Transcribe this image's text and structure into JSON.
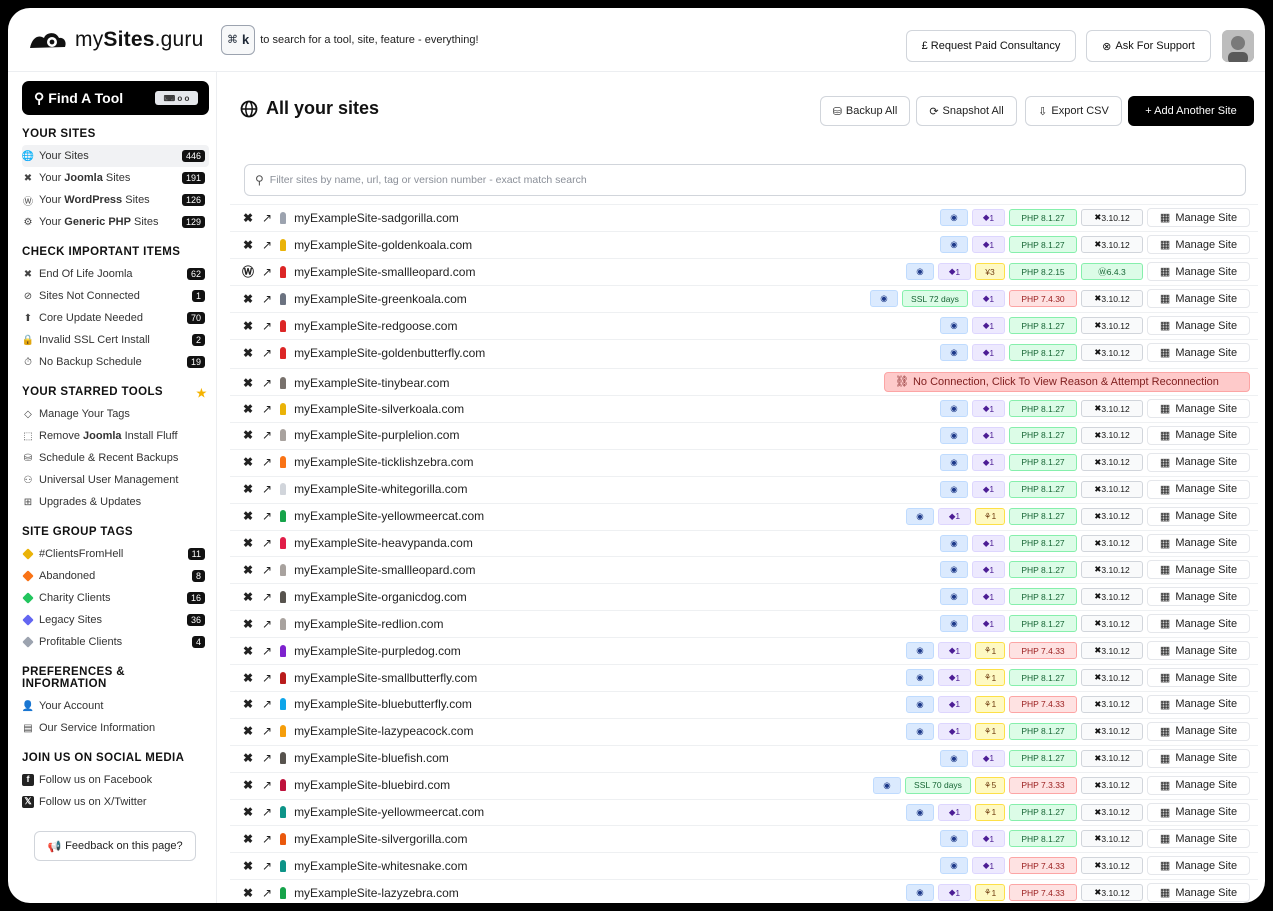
{
  "brand": {
    "prefix": "my",
    "bold": "Sites",
    "suffix": ".guru"
  },
  "topbar": {
    "kbd_symbol": "⌘",
    "kbd_key": "k",
    "search_hint": "to search for a tool, site, feature - everything!",
    "consultancy_label": "£ Request Paid Consultancy",
    "support_label": "Ask For Support"
  },
  "sidebar": {
    "find_tool": "Find A Tool",
    "find_tool_pill": "⌨ o o",
    "sections": {
      "your_sites": "YOUR SITES",
      "check": "CHECK IMPORTANT ITEMS",
      "starred": "YOUR STARRED TOOLS",
      "tags": "SITE GROUP TAGS",
      "prefs": "PREFERENCES & INFORMATION",
      "social": "JOIN US ON SOCIAL MEDIA"
    },
    "your_sites": [
      {
        "pre": "Your Sites",
        "bold": "",
        "post": "",
        "count": "446"
      },
      {
        "pre": "Your ",
        "bold": "Joomla",
        "post": " Sites",
        "count": "191"
      },
      {
        "pre": "Your ",
        "bold": "WordPress",
        "post": " Sites",
        "count": "126"
      },
      {
        "pre": "Your ",
        "bold": "Generic PHP",
        "post": " Sites",
        "count": "129"
      }
    ],
    "check": [
      {
        "label": "End Of Life Joomla",
        "count": "62"
      },
      {
        "label": "Sites Not Connected",
        "count": "1"
      },
      {
        "label": "Core Update Needed",
        "count": "70"
      },
      {
        "label": "Invalid SSL Cert Install",
        "count": "2"
      },
      {
        "label": "No Backup Schedule",
        "count": "19"
      }
    ],
    "starred": [
      {
        "pre": "Manage Your Tags",
        "bold": "",
        "post": ""
      },
      {
        "pre": "Remove ",
        "bold": "Joomla",
        "post": " Install Fluff"
      },
      {
        "pre": "Schedule & Recent Backups",
        "bold": "",
        "post": ""
      },
      {
        "pre": "Universal User Management",
        "bold": "",
        "post": ""
      },
      {
        "pre": "Upgrades & Updates",
        "bold": "",
        "post": ""
      }
    ],
    "tags": [
      {
        "label": "#ClientsFromHell",
        "count": "11",
        "color": "#eab308"
      },
      {
        "label": "Abandoned",
        "count": "8",
        "color": "#f97316"
      },
      {
        "label": "Charity Clients",
        "count": "16",
        "color": "#22c55e"
      },
      {
        "label": "Legacy Sites",
        "count": "36",
        "color": "#6366f1"
      },
      {
        "label": "Profitable Clients",
        "count": "4",
        "color": "#9ca3af"
      }
    ],
    "prefs": [
      "Your Account",
      "Our Service Information"
    ],
    "social": [
      "Follow us on Facebook",
      "Follow us on X/Twitter"
    ],
    "feedback": "Feedback on this page?"
  },
  "main": {
    "title": "All your sites",
    "backup_all": "Backup All",
    "snapshot_all": "Snapshot All",
    "export_csv": "Export CSV",
    "add_site": "+ Add Another Site",
    "filter_placeholder": "Filter sites by name, url, tag or version number - exact match search",
    "manage_label": "Manage Site",
    "no_connection": "No Connection, Click To View Reason & Attempt Reconnection"
  },
  "sites": [
    {
      "name": "myExampleSite-sadgorilla.com",
      "cms": "joomla",
      "color": "#9ca3af",
      "ssl": "",
      "tag": "1",
      "extra": "",
      "php": "PHP 8.1.27",
      "php_old": false,
      "ver": "3.10.12"
    },
    {
      "name": "myExampleSite-goldenkoala.com",
      "cms": "joomla",
      "color": "#eab308",
      "ssl": "",
      "tag": "1",
      "extra": "",
      "php": "PHP 8.1.27",
      "php_old": false,
      "ver": "3.10.12"
    },
    {
      "name": "myExampleSite-smallleopard.com",
      "cms": "wordpress",
      "color": "#dc2626",
      "ssl": "",
      "tag": "1",
      "extra": "¥3",
      "php": "PHP 8.2.15",
      "php_old": false,
      "ver": "6.4.3"
    },
    {
      "name": "myExampleSite-greenkoala.com",
      "cms": "joomla",
      "color": "#6b7280",
      "ssl": "SSL 72 days",
      "tag": "1",
      "extra": "",
      "php": "PHP 7.4.30",
      "php_old": true,
      "ver": "3.10.12"
    },
    {
      "name": "myExampleSite-redgoose.com",
      "cms": "joomla",
      "color": "#dc2626",
      "ssl": "",
      "tag": "1",
      "extra": "",
      "php": "PHP 8.1.27",
      "php_old": false,
      "ver": "3.10.12"
    },
    {
      "name": "myExampleSite-goldenbutterfly.com",
      "cms": "joomla",
      "color": "#dc2626",
      "ssl": "",
      "tag": "1",
      "extra": "",
      "php": "PHP 8.1.27",
      "php_old": false,
      "ver": "3.10.12"
    },
    {
      "name": "myExampleSite-tinybear.com",
      "cms": "joomla",
      "color": "#78716c",
      "noconn": true
    },
    {
      "name": "myExampleSite-silverkoala.com",
      "cms": "joomla",
      "color": "#eab308",
      "ssl": "",
      "tag": "1",
      "extra": "",
      "php": "PHP 8.1.27",
      "php_old": false,
      "ver": "3.10.12"
    },
    {
      "name": "myExampleSite-purplelion.com",
      "cms": "joomla",
      "color": "#a8a29e",
      "ssl": "",
      "tag": "1",
      "extra": "",
      "php": "PHP 8.1.27",
      "php_old": false,
      "ver": "3.10.12"
    },
    {
      "name": "myExampleSite-ticklishzebra.com",
      "cms": "joomla",
      "color": "#f97316",
      "ssl": "",
      "tag": "1",
      "extra": "",
      "php": "PHP 8.1.27",
      "php_old": false,
      "ver": "3.10.12"
    },
    {
      "name": "myExampleSite-whitegorilla.com",
      "cms": "joomla",
      "color": "#d1d5db",
      "ssl": "",
      "tag": "1",
      "extra": "",
      "php": "PHP 8.1.27",
      "php_old": false,
      "ver": "3.10.12"
    },
    {
      "name": "myExampleSite-yellowmeercat.com",
      "cms": "joomla",
      "color": "#16a34a",
      "ssl": "",
      "tag": "1",
      "extra": "1",
      "php": "PHP 8.1.27",
      "php_old": false,
      "ver": "3.10.12"
    },
    {
      "name": "myExampleSite-heavypanda.com",
      "cms": "joomla",
      "color": "#e11d48",
      "ssl": "",
      "tag": "1",
      "extra": "",
      "php": "PHP 8.1.27",
      "php_old": false,
      "ver": "3.10.12"
    },
    {
      "name": "myExampleSite-smallleopard.com",
      "cms": "joomla",
      "color": "#a8a29e",
      "ssl": "",
      "tag": "1",
      "extra": "",
      "php": "PHP 8.1.27",
      "php_old": false,
      "ver": "3.10.12"
    },
    {
      "name": "myExampleSite-organicdog.com",
      "cms": "joomla",
      "color": "#57534e",
      "ssl": "",
      "tag": "1",
      "extra": "",
      "php": "PHP 8.1.27",
      "php_old": false,
      "ver": "3.10.12"
    },
    {
      "name": "myExampleSite-redlion.com",
      "cms": "joomla",
      "color": "#a8a29e",
      "ssl": "",
      "tag": "1",
      "extra": "",
      "php": "PHP 8.1.27",
      "php_old": false,
      "ver": "3.10.12"
    },
    {
      "name": "myExampleSite-purpledog.com",
      "cms": "joomla",
      "color": "#7e22ce",
      "ssl": "",
      "tag": "1",
      "extra": "1",
      "php": "PHP 7.4.33",
      "php_old": true,
      "ver": "3.10.12"
    },
    {
      "name": "myExampleSite-smallbutterfly.com",
      "cms": "joomla",
      "color": "#b91c1c",
      "ssl": "",
      "tag": "1",
      "extra": "1",
      "php": "PHP 8.1.27",
      "php_old": false,
      "ver": "3.10.12"
    },
    {
      "name": "myExampleSite-bluebutterfly.com",
      "cms": "joomla",
      "color": "#0ea5e9",
      "ssl": "",
      "tag": "1",
      "extra": "1",
      "php": "PHP 7.4.33",
      "php_old": true,
      "ver": "3.10.12"
    },
    {
      "name": "myExampleSite-lazypeacock.com",
      "cms": "joomla",
      "color": "#f59e0b",
      "ssl": "",
      "tag": "1",
      "extra": "1",
      "php": "PHP 8.1.27",
      "php_old": false,
      "ver": "3.10.12"
    },
    {
      "name": "myExampleSite-bluefish.com",
      "cms": "joomla",
      "color": "#57534e",
      "ssl": "",
      "tag": "1",
      "extra": "",
      "php": "PHP 8.1.27",
      "php_old": false,
      "ver": "3.10.12"
    },
    {
      "name": "myExampleSite-bluebird.com",
      "cms": "joomla",
      "color": "#be123c",
      "ssl": "SSL 70 days",
      "tag": "",
      "extra": "5",
      "php": "PHP 7.3.33",
      "php_old": true,
      "ver": "3.10.12"
    },
    {
      "name": "myExampleSite-yellowmeercat.com",
      "cms": "joomla",
      "color": "#0d9488",
      "ssl": "",
      "tag": "1",
      "extra": "1",
      "php": "PHP 8.1.27",
      "php_old": false,
      "ver": "3.10.12"
    },
    {
      "name": "myExampleSite-silvergorilla.com",
      "cms": "joomla",
      "color": "#ea580c",
      "ssl": "",
      "tag": "1",
      "extra": "",
      "php": "PHP 8.1.27",
      "php_old": false,
      "ver": "3.10.12"
    },
    {
      "name": "myExampleSite-whitesnake.com",
      "cms": "joomla",
      "color": "#0d9488",
      "ssl": "",
      "tag": "1",
      "extra": "",
      "php": "PHP 7.4.33",
      "php_old": true,
      "ver": "3.10.12"
    },
    {
      "name": "myExampleSite-lazyzebra.com",
      "cms": "joomla",
      "color": "#16a34a",
      "ssl": "",
      "tag": "1",
      "extra": "1",
      "php": "PHP 7.4.33",
      "php_old": true,
      "ver": "3.10.12"
    }
  ]
}
